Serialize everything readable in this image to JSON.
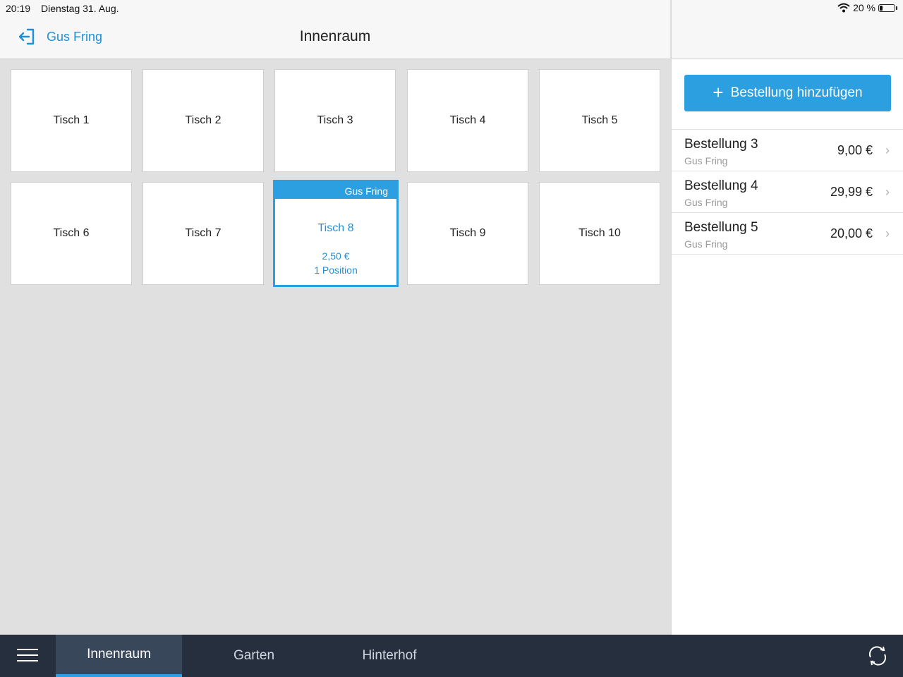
{
  "status": {
    "time": "20:19",
    "date": "Dienstag 31. Aug.",
    "battery": "20 %",
    "battery_level": 0.2
  },
  "header": {
    "user": "Gus Fring",
    "title": "Innenraum"
  },
  "tables": [
    {
      "label": "Tisch 1"
    },
    {
      "label": "Tisch 2"
    },
    {
      "label": "Tisch 3"
    },
    {
      "label": "Tisch 4"
    },
    {
      "label": "Tisch 5"
    },
    {
      "label": "Tisch 6"
    },
    {
      "label": "Tisch 7"
    },
    {
      "label": "Tisch 8",
      "active": true,
      "waiter": "Gus Fring",
      "amount": "2,50 €",
      "positions": "1 Position"
    },
    {
      "label": "Tisch 9"
    },
    {
      "label": "Tisch 10"
    }
  ],
  "sidebar": {
    "add_label": "Bestellung hinzufügen",
    "orders": [
      {
        "name": "Bestellung 3",
        "waiter": "Gus Fring",
        "price": "9,00 €"
      },
      {
        "name": "Bestellung 4",
        "waiter": "Gus Fring",
        "price": "29,99 €"
      },
      {
        "name": "Bestellung 5",
        "waiter": "Gus Fring",
        "price": "20,00 €"
      }
    ]
  },
  "tabs": [
    {
      "label": "Innenraum",
      "active": true
    },
    {
      "label": "Garten"
    },
    {
      "label": "Hinterhof"
    }
  ],
  "colors": {
    "accent": "#2b9fe0",
    "bottom_bar": "#252f3d"
  }
}
